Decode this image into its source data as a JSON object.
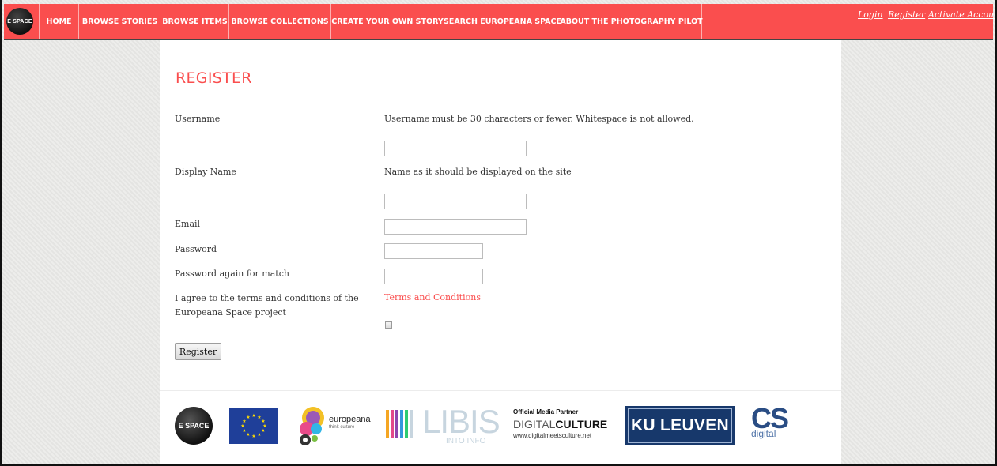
{
  "header": {
    "logo_text": "E SPACE",
    "nav": [
      {
        "label": "HOME"
      },
      {
        "label": "BROWSE STORIES"
      },
      {
        "label": "BROWSE ITEMS"
      },
      {
        "label": "BROWSE COLLECTIONS"
      },
      {
        "label": "CREATE YOUR OWN STORY"
      },
      {
        "label": "SEARCH EUROPEANA SPACE"
      },
      {
        "label": "ABOUT THE PHOTOGRAPHY PILOT"
      }
    ],
    "account_links": [
      "Login",
      "Register",
      "Activate Account"
    ]
  },
  "form": {
    "title": "REGISTER",
    "username_label": "Username",
    "username_help": "Username must be 30 characters or fewer. Whitespace is not allowed.",
    "username_value": "",
    "display_name_label": "Display Name",
    "display_name_help": "Name as it should be displayed on the site",
    "display_name_value": "",
    "email_label": "Email",
    "email_value": "",
    "password_label": "Password",
    "password_value": "",
    "password2_label": "Password again for match",
    "password2_value": "",
    "terms_label": "I agree to the terms and conditions of the Europeana Space project",
    "terms_link": "Terms and Conditions",
    "terms_checked": false,
    "submit_label": "Register"
  },
  "footer": {
    "logos": {
      "espace": "E SPACE",
      "europeana": "europeana",
      "europeana_tagline": "think culture",
      "libis": "LIBIS",
      "libis_tagline": "INTO INFO",
      "dmc_heading": "Official Media Partner",
      "dmc_name_light": "DIGITAL",
      "dmc_name_bold": "CULTURE",
      "dmc_url": "www.digitalmeetsculture.net",
      "kuleuven": "KU LEUVEN",
      "csdigital": "CS",
      "csdigital_sub": "digital"
    }
  },
  "colors": {
    "brand_red": "#fa4e4e",
    "kuleuven_blue": "#17386b",
    "eu_blue": "#1f3f99"
  }
}
